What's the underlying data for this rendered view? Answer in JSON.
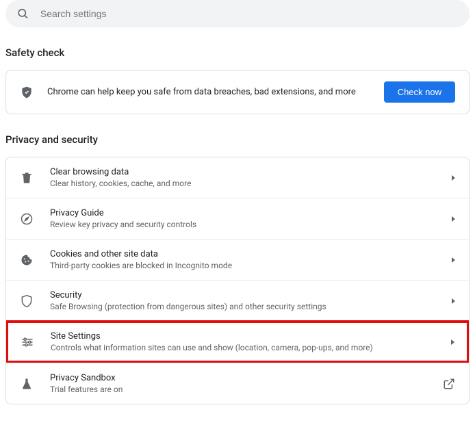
{
  "search": {
    "placeholder": "Search settings"
  },
  "safetyCheck": {
    "title": "Safety check",
    "text": "Chrome can help keep you safe from data breaches, bad extensions, and more",
    "button": "Check now"
  },
  "privacySecurity": {
    "title": "Privacy and security",
    "items": [
      {
        "title": "Clear browsing data",
        "subtitle": "Clear history, cookies, cache, and more",
        "icon": "trash",
        "action": "chevron"
      },
      {
        "title": "Privacy Guide",
        "subtitle": "Review key privacy and security controls",
        "icon": "compass",
        "action": "chevron"
      },
      {
        "title": "Cookies and other site data",
        "subtitle": "Third-party cookies are blocked in Incognito mode",
        "icon": "cookie",
        "action": "chevron"
      },
      {
        "title": "Security",
        "subtitle": "Safe Browsing (protection from dangerous sites) and other security settings",
        "icon": "shield",
        "action": "chevron"
      },
      {
        "title": "Site Settings",
        "subtitle": "Controls what information sites can use and show (location, camera, pop-ups, and more)",
        "icon": "sliders",
        "action": "chevron",
        "highlighted": true
      },
      {
        "title": "Privacy Sandbox",
        "subtitle": "Trial features are on",
        "icon": "flask",
        "action": "external"
      }
    ]
  }
}
